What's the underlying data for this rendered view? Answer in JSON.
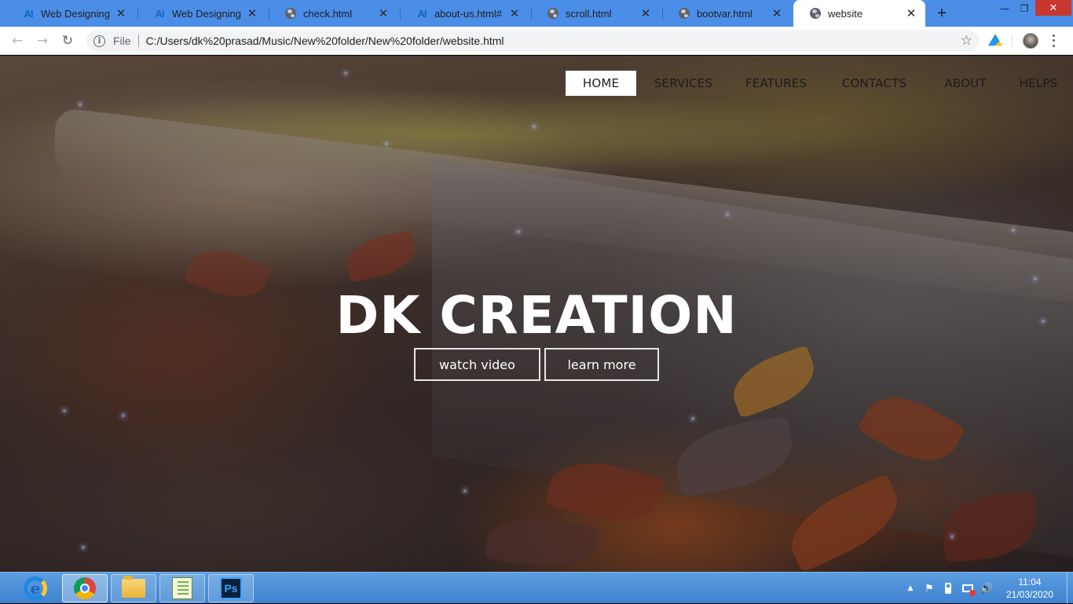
{
  "browser": {
    "tabs": [
      {
        "title": "Web Designing | W",
        "icon": "ai-icon",
        "active": false
      },
      {
        "title": "Web Designing | W",
        "icon": "ai-icon",
        "active": false
      },
      {
        "title": "check.html",
        "icon": "globe-icon",
        "active": false
      },
      {
        "title": "about-us.html#",
        "icon": "ai-icon",
        "active": false
      },
      {
        "title": "scroll.html",
        "icon": "globe-icon",
        "active": false
      },
      {
        "title": "bootvar.html",
        "icon": "globe-icon",
        "active": false
      },
      {
        "title": "website",
        "icon": "globe-icon",
        "active": true
      }
    ],
    "tab_close_glyph": "✕",
    "ai_icon_text": "AI",
    "new_tab_glyph": "+",
    "window_controls": {
      "minimize": "—",
      "restore": "❐",
      "close": "✕"
    },
    "nav": {
      "back": "←",
      "forward": "→",
      "reload": "↻"
    },
    "omnibox": {
      "info_glyph": "i",
      "scheme_label": "File",
      "url": "C:/Users/dk%20prasad/Music/New%20folder/New%20folder/website.html",
      "bookmark_glyph": "☆"
    }
  },
  "page": {
    "nav_items": [
      {
        "label": "HOME",
        "active": true
      },
      {
        "label": "SERVICES",
        "active": false
      },
      {
        "label": "FEATURES",
        "active": false
      },
      {
        "label": "CONTACTS",
        "active": false
      },
      {
        "label": "ABOUT",
        "active": false
      },
      {
        "label": "HELPS",
        "active": false
      }
    ],
    "hero_title": "DK CREATION",
    "buttons": {
      "watch_video": "watch video",
      "learn_more": "learn more"
    }
  },
  "taskbar": {
    "apps": [
      {
        "name": "internet-explorer-icon",
        "state": "pinned"
      },
      {
        "name": "chrome-icon",
        "state": "running"
      },
      {
        "name": "file-explorer-icon",
        "state": "pinned"
      },
      {
        "name": "notepad-plus-icon",
        "state": "pinned"
      },
      {
        "name": "photoshop-icon",
        "state": "pinned"
      }
    ],
    "ie_glyph": "e",
    "ps_label": "Ps",
    "tray": {
      "overflow_glyph": "▲",
      "flag_glyph": "⚑",
      "volume_glyph": "🔊"
    },
    "clock": {
      "time": "11:04",
      "date": "21/03/2020"
    }
  },
  "colors": {
    "tabstrip": "#4a8ee8",
    "taskbar": "#3f82cf",
    "hero_text": "#ffffff",
    "nav_active_bg": "#ffffff"
  }
}
